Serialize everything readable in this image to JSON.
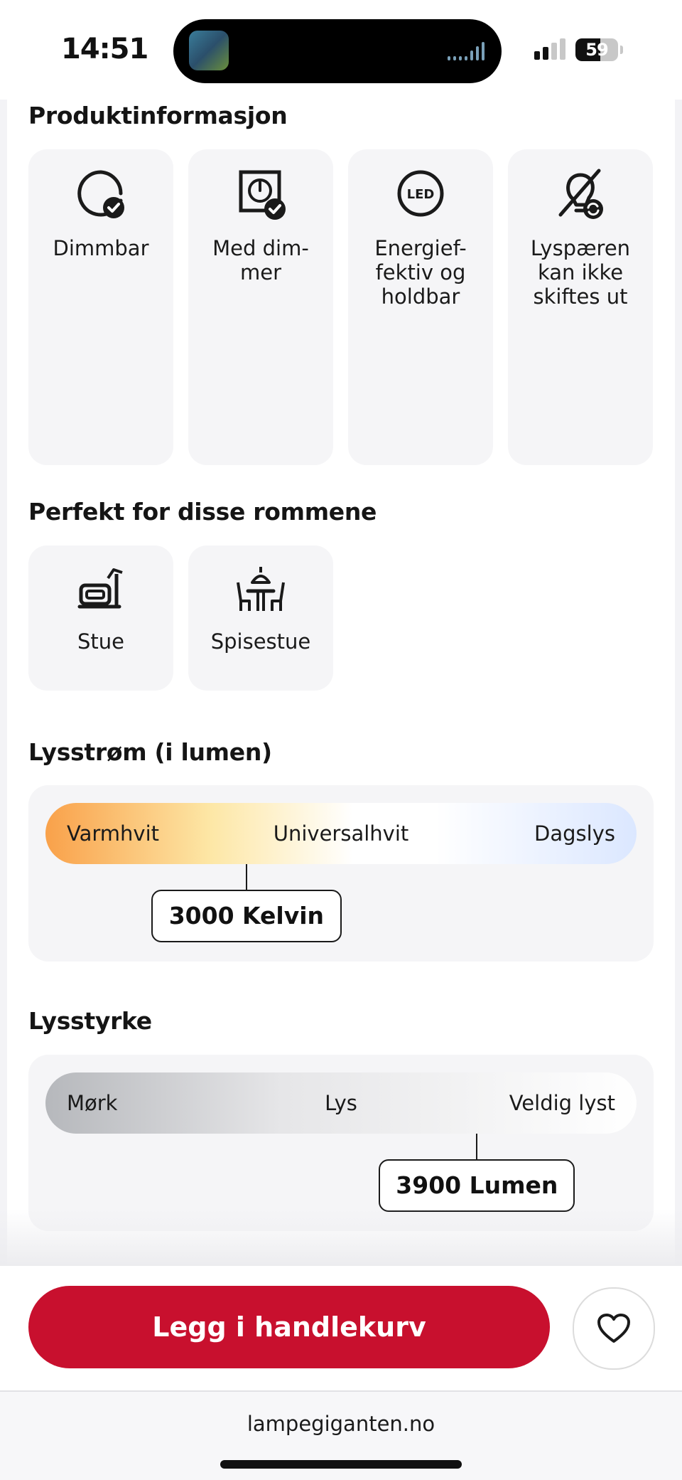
{
  "status_bar": {
    "time": "14:51",
    "battery": "59",
    "battery_level": 0.59,
    "signal_bars_active": 2,
    "icons": [
      "app-thumbnail-icon",
      "audio-wave-icon",
      "cellular-signal-icon",
      "battery-icon"
    ]
  },
  "product_info": {
    "title": "Produktinformasjon",
    "items": [
      {
        "label": "Dimmbar",
        "icon": "dimmable-icon"
      },
      {
        "label": "Med dim- mer",
        "icon": "dimmer-switch-icon"
      },
      {
        "label": "Energief- fektiv og holdbar",
        "icon": "led-icon"
      },
      {
        "label": "Lyspæren kan ikke skiftes ut",
        "icon": "non-replaceable-bulb-icon"
      }
    ]
  },
  "rooms": {
    "title": "Perfekt for disse rommene",
    "items": [
      {
        "label": "Stue",
        "icon": "living-room-icon"
      },
      {
        "label": "Spisestue",
        "icon": "dining-room-icon"
      }
    ]
  },
  "color_temperature": {
    "title": "Lysstrøm (i lumen)",
    "scale_labels": [
      "Varmhvit",
      "Universalhvit",
      "Dagslys"
    ],
    "value_label": "3000 Kelvin",
    "position": 0.34,
    "colors": {
      "warm": "#f9a14a",
      "neutral": "#ffffff",
      "cool": "#dbe7ff"
    }
  },
  "brightness": {
    "title": "Lysstyrke",
    "scale_labels": [
      "Mørk",
      "Lys",
      "Veldig lyst"
    ],
    "value_label": "3900 Lumen",
    "position": 0.73,
    "colors": {
      "dark": "#b6b8bc",
      "light": "#ffffff"
    }
  },
  "actions": {
    "add_to_cart": "Legg i handlekurv",
    "favorite_icon": "heart-icon",
    "accent": "#c8102e"
  },
  "browser": {
    "url": "lampegiganten.no"
  }
}
